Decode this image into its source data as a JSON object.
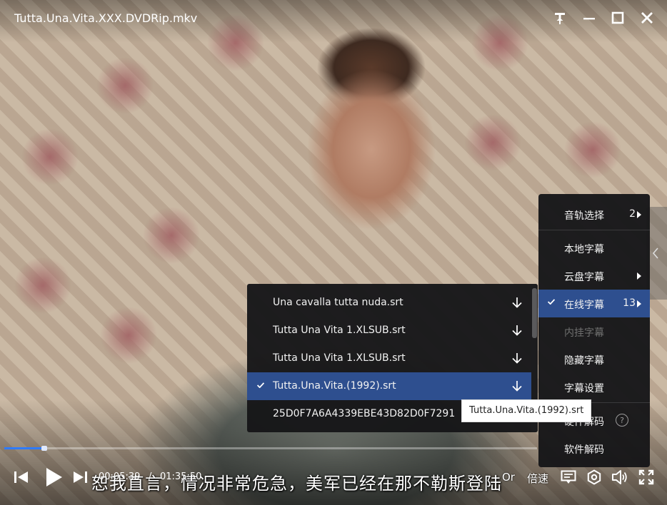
{
  "window": {
    "title": "Tutta.Una.Vita.XXX.DVDRip.mkv",
    "buttons": [
      "pin-icon",
      "minimize-icon",
      "maximize-icon",
      "close-icon"
    ]
  },
  "context_menu": {
    "items": [
      {
        "label": "音轨选择",
        "count": "2",
        "submenu": true
      },
      {
        "label": "本地字幕"
      },
      {
        "label": "云盘字幕",
        "submenu": true
      },
      {
        "label": "在线字幕",
        "count": "13",
        "submenu": true,
        "checked": true
      },
      {
        "label": "内挂字幕",
        "disabled": true
      },
      {
        "label": "隐藏字幕"
      },
      {
        "label": "字幕设置"
      },
      {
        "label": "硬件解码",
        "help": "?"
      },
      {
        "label": "软件解码"
      }
    ]
  },
  "online_subtitles": {
    "items": [
      {
        "name": "Una cavalla tutta nuda.srt"
      },
      {
        "name": "Tutta Una Vita 1.XLSUB.srt"
      },
      {
        "name": "Tutta Una Vita 1.XLSUB.srt"
      },
      {
        "name": "Tutta.Una.Vita.(1992).srt",
        "checked": true
      },
      {
        "name": "25D0F7A6A4339EBE43D82D0F7291"
      }
    ],
    "tooltip": "Tutta.Una.Vita.(1992).srt"
  },
  "player": {
    "progress": 0.0754,
    "current_time": "00:05:39",
    "separator": "/",
    "total_time": "01:35:50",
    "subtitle_text": "恕我直言，情况非常危急，美军已经在那不勒斯登陆",
    "rate_label": "Or",
    "speed_label": "倍速"
  },
  "colors": {
    "accent": "#2e4f8f",
    "progress": "#2f7bff",
    "menu_bg": "#161618"
  }
}
